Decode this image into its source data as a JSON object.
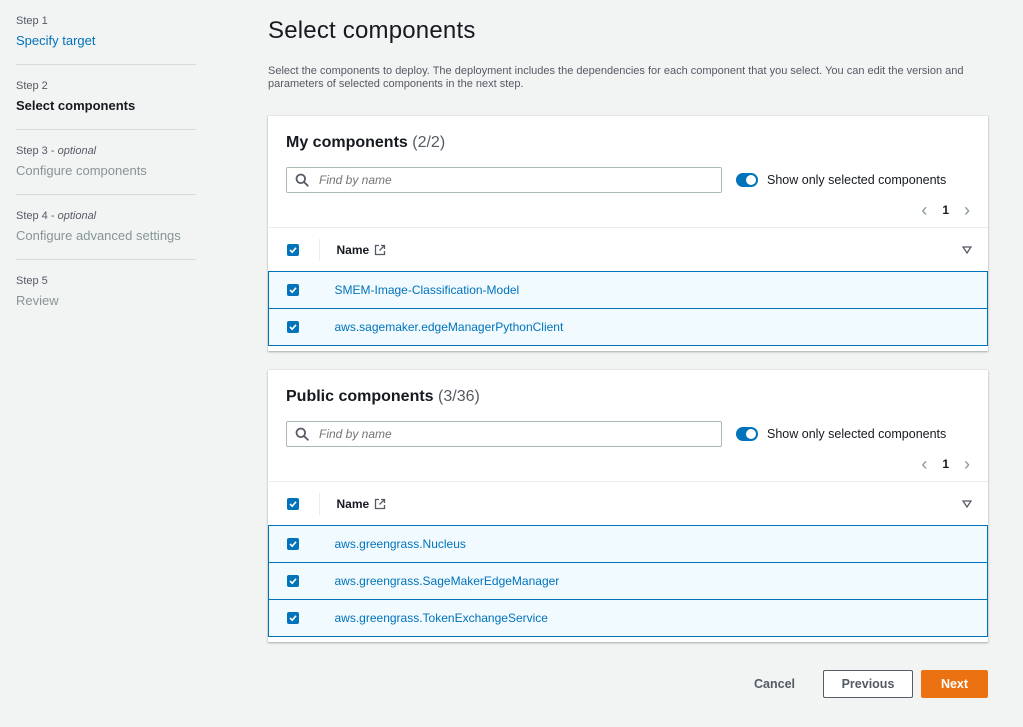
{
  "steps": [
    {
      "label": "Step 1",
      "optional": "",
      "title": "Specify target",
      "state": "link"
    },
    {
      "label": "Step 2",
      "optional": "",
      "title": "Select components",
      "state": "active"
    },
    {
      "label": "Step 3",
      "optional": "optional",
      "title": "Configure components",
      "state": "disabled"
    },
    {
      "label": "Step 4",
      "optional": "optional",
      "title": "Configure advanced settings",
      "state": "disabled"
    },
    {
      "label": "Step 5",
      "optional": "",
      "title": "Review",
      "state": "disabled"
    }
  ],
  "page": {
    "title": "Select components",
    "description": "Select the components to deploy. The deployment includes the dependencies for each component that you select. You can edit the version and parameters of selected components in the next step."
  },
  "my_components": {
    "title": "My components",
    "count": "(2/2)",
    "search_placeholder": "Find by name",
    "toggle_label": "Show only selected components",
    "toggle_on": true,
    "page_number": "1",
    "column_name": "Name",
    "rows": [
      "SMEM-Image-Classification-Model",
      "aws.sagemaker.edgeManagerPythonClient"
    ]
  },
  "public_components": {
    "title": "Public components",
    "count": "(3/36)",
    "search_placeholder": "Find by name",
    "toggle_label": "Show only selected components",
    "toggle_on": true,
    "page_number": "1",
    "column_name": "Name",
    "rows": [
      "aws.greengrass.Nucleus",
      "aws.greengrass.SageMakerEdgeManager",
      "aws.greengrass.TokenExchangeService"
    ]
  },
  "footer": {
    "cancel": "Cancel",
    "previous": "Previous",
    "next": "Next"
  },
  "colors": {
    "accent": "#0073bb",
    "primary_button": "#ec7211",
    "selected_row_bg": "#f1faff"
  }
}
